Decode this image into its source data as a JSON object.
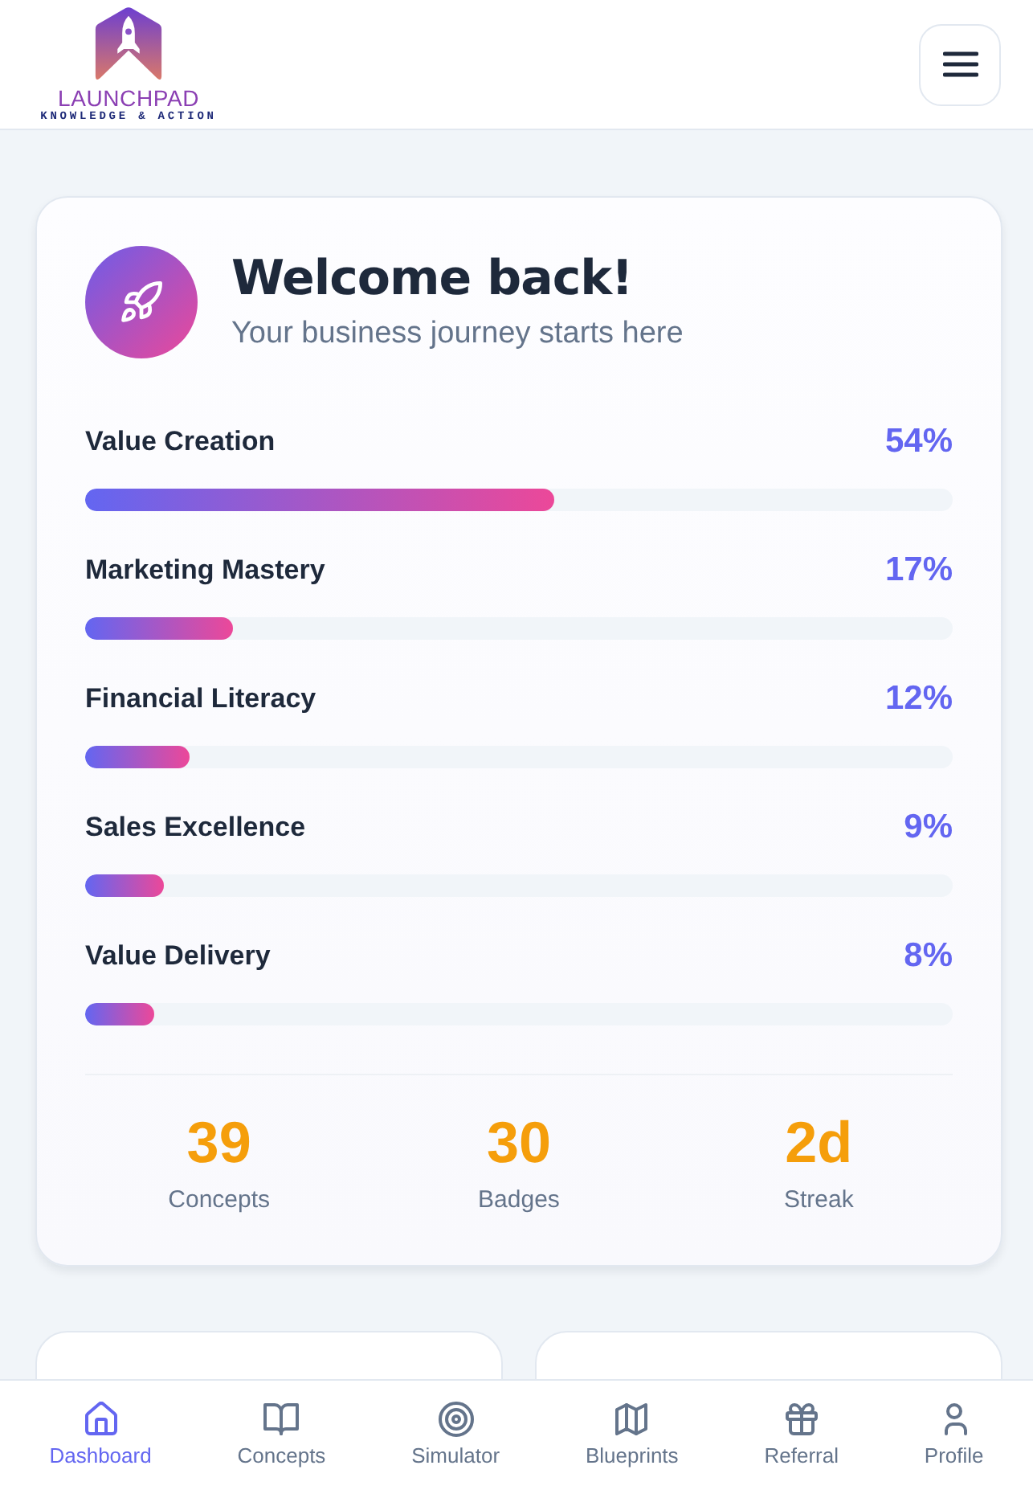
{
  "header": {
    "logo_name": "LAUNCHPAD",
    "logo_tagline": "KNOWLEDGE & ACTION"
  },
  "welcome": {
    "title": "Welcome back!",
    "subtitle": "Your business journey starts here"
  },
  "progress": [
    {
      "name": "Value Creation",
      "percent": "54%",
      "level": 0.54
    },
    {
      "name": "Marketing Mastery",
      "percent": "17%",
      "level": 0.17
    },
    {
      "name": "Financial Literacy",
      "percent": "12%",
      "level": 0.12
    },
    {
      "name": "Sales Excellence",
      "percent": "9%",
      "level": 0.09
    },
    {
      "name": "Value Delivery",
      "percent": "8%",
      "level": 0.08
    }
  ],
  "stats": [
    {
      "value": "39",
      "label": "Concepts"
    },
    {
      "value": "30",
      "label": "Badges"
    },
    {
      "value": "2d",
      "label": "Streak"
    }
  ],
  "nav": [
    {
      "label": "Dashboard",
      "kind": "home",
      "selected": true
    },
    {
      "label": "Concepts",
      "kind": "book",
      "selected": false
    },
    {
      "label": "Simulator",
      "kind": "target",
      "selected": false
    },
    {
      "label": "Blueprints",
      "kind": "map",
      "selected": false
    },
    {
      "label": "Referral",
      "kind": "gift",
      "selected": false
    },
    {
      "label": "Profile",
      "kind": "user",
      "selected": false
    }
  ]
}
